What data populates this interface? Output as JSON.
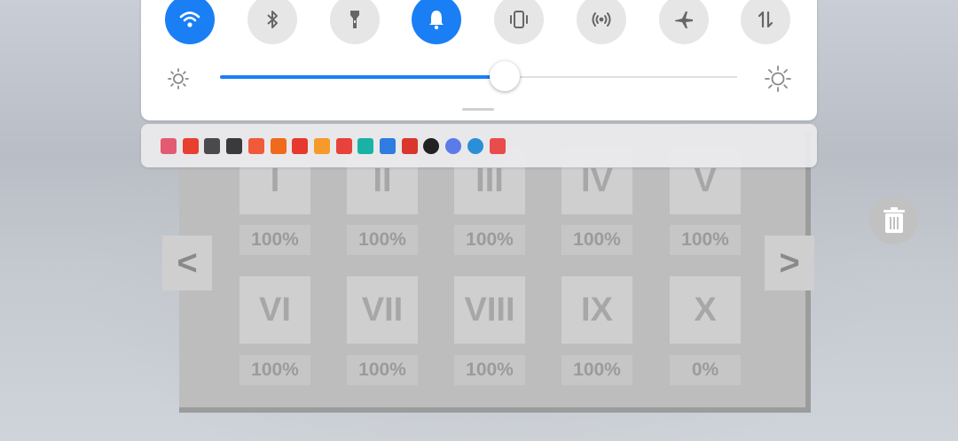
{
  "quick_settings": {
    "toggles": [
      {
        "icon": "wifi-icon",
        "active": true
      },
      {
        "icon": "bluetooth-icon",
        "active": false
      },
      {
        "icon": "flashlight-icon",
        "active": false
      },
      {
        "icon": "bell-icon",
        "active": true
      },
      {
        "icon": "vibrate-icon",
        "active": false
      },
      {
        "icon": "hotspot-icon",
        "active": false
      },
      {
        "icon": "airplane-icon",
        "active": false
      },
      {
        "icon": "data-transfer-icon",
        "active": false
      }
    ],
    "brightness": {
      "value": 0.55
    },
    "accent": "#1a7ff5"
  },
  "app_strip": {
    "icons": [
      {
        "name": "app-icon-1",
        "color": "#e35b72"
      },
      {
        "name": "app-icon-2",
        "color": "#e84030"
      },
      {
        "name": "app-icon-3",
        "color": "#4a4a4a"
      },
      {
        "name": "app-icon-4",
        "color": "#3a3a3a"
      },
      {
        "name": "app-icon-5",
        "color": "#ef5b3a"
      },
      {
        "name": "app-icon-6",
        "color": "#f06a1e"
      },
      {
        "name": "app-icon-7",
        "color": "#e63a2f"
      },
      {
        "name": "app-icon-8",
        "color": "#f59a2b"
      },
      {
        "name": "app-icon-9",
        "color": "#e8423c"
      },
      {
        "name": "app-icon-10",
        "color": "#19b3a6"
      },
      {
        "name": "app-icon-11",
        "color": "#2f7de1"
      },
      {
        "name": "app-icon-12",
        "color": "#d9362e"
      },
      {
        "name": "app-icon-13",
        "color": "#222222"
      },
      {
        "name": "app-icon-14",
        "color": "#5a7be8"
      },
      {
        "name": "app-icon-15",
        "color": "#2a8fd6"
      },
      {
        "name": "app-icon-16",
        "color": "#ea4b4b"
      }
    ]
  },
  "levels": {
    "tiles": [
      {
        "label": "I",
        "pct": "100%"
      },
      {
        "label": "II",
        "pct": "100%"
      },
      {
        "label": "III",
        "pct": "100%"
      },
      {
        "label": "IV",
        "pct": "100%"
      },
      {
        "label": "V",
        "pct": "100%"
      },
      {
        "label": "VI",
        "pct": "100%"
      },
      {
        "label": "VII",
        "pct": "100%"
      },
      {
        "label": "VIII",
        "pct": "100%"
      },
      {
        "label": "IX",
        "pct": "100%"
      },
      {
        "label": "X",
        "pct": "0%"
      }
    ],
    "prev_label": "<",
    "next_label": ">"
  }
}
